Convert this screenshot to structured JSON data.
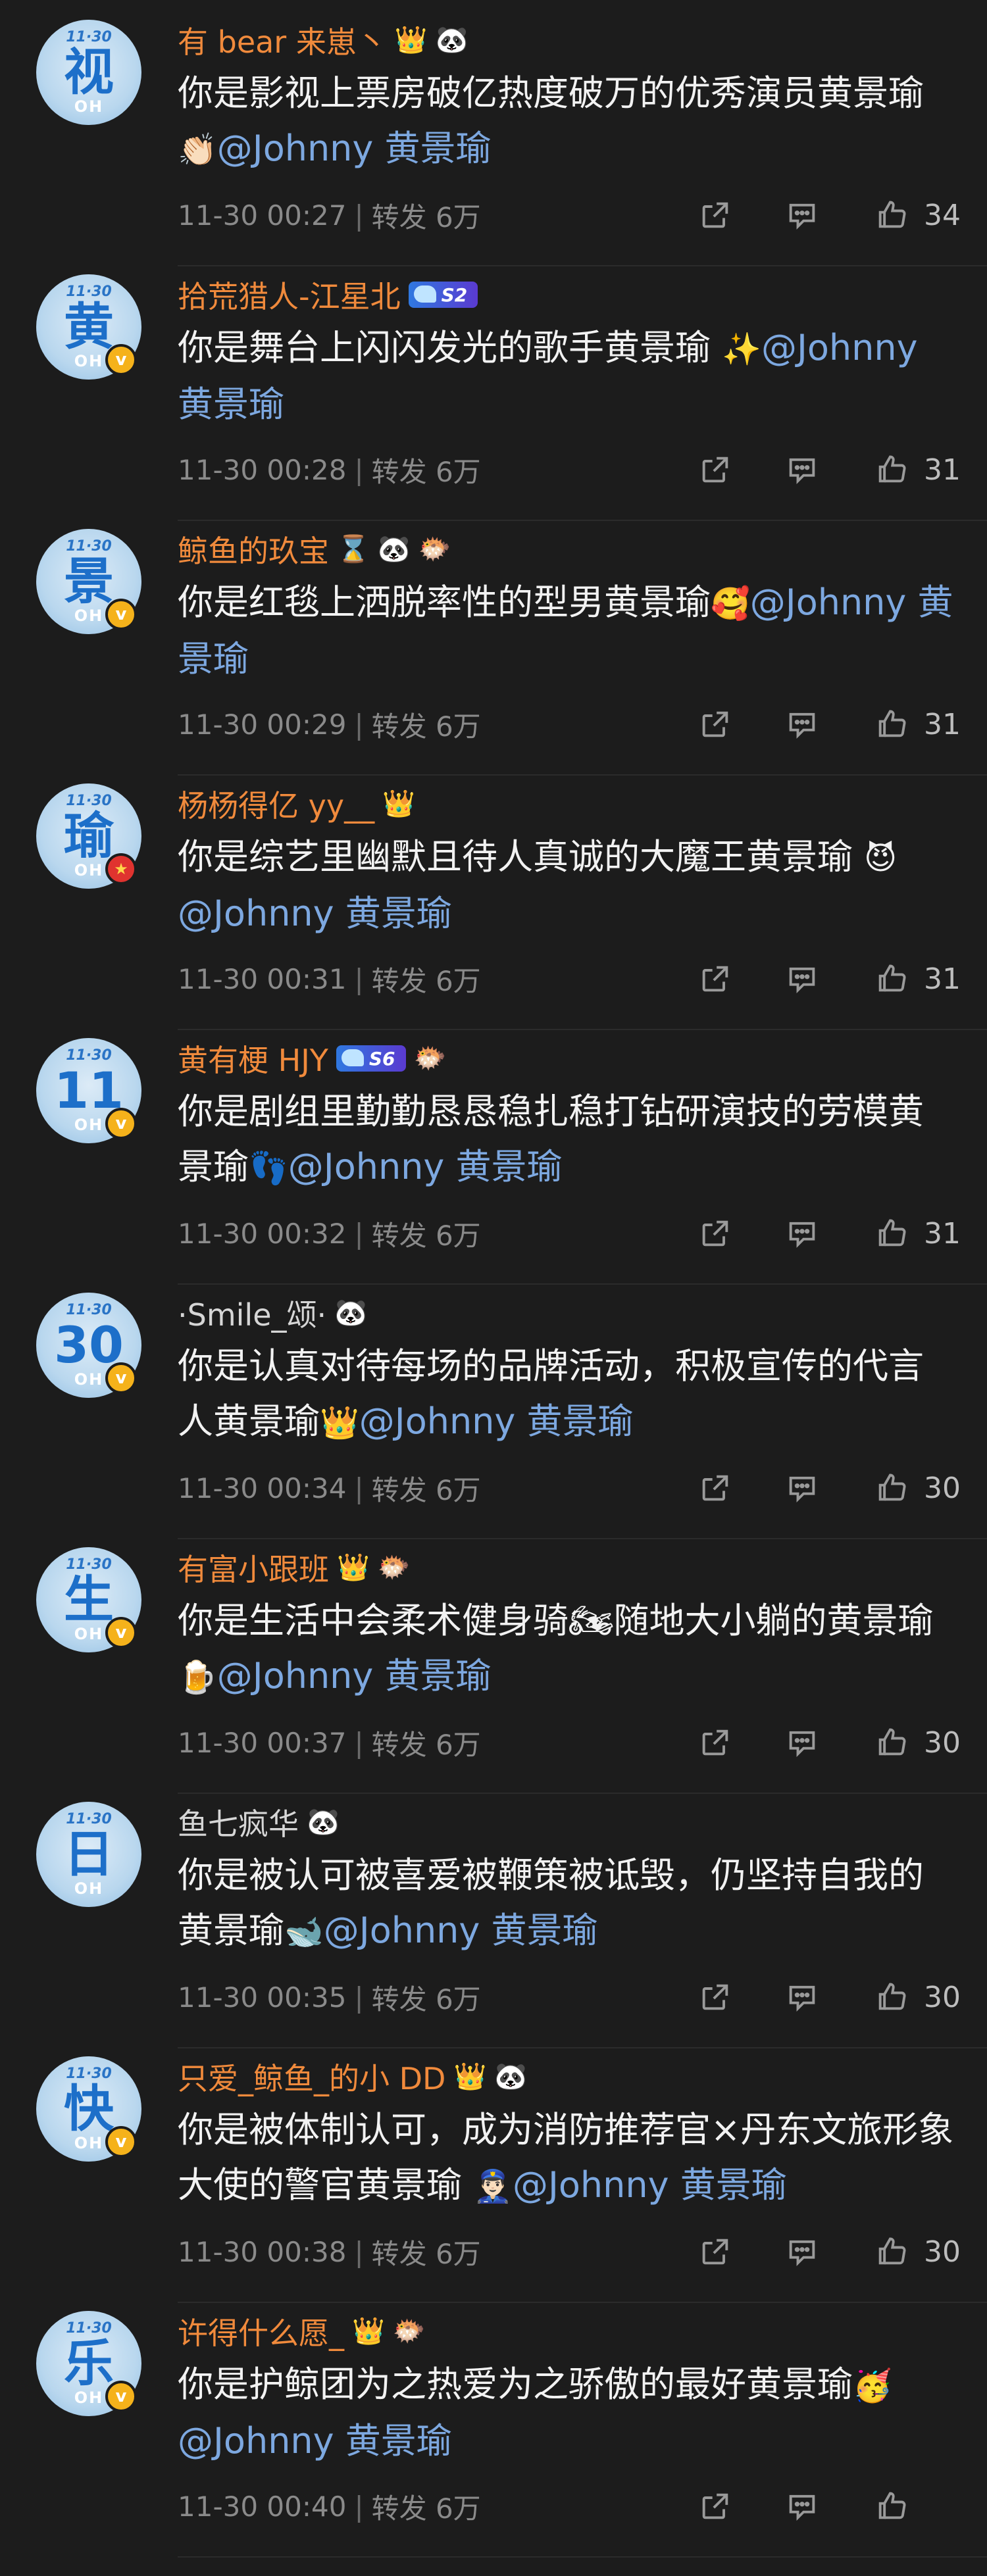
{
  "footer_labels": {
    "repost_prefix": "转发"
  },
  "colors": {
    "background": "#1c1c1c",
    "username_highlight": "#f08a3c",
    "mention": "#7da8e0",
    "meta": "#8a8a8a"
  },
  "comments": [
    {
      "avatar_char": "视",
      "avatar_top": "11·30",
      "avatar_bottom": "OH",
      "badge": "none",
      "username": "有 bear 来崽丶",
      "username_style": "orange",
      "medals": [
        "👑",
        "🐼"
      ],
      "level_badge": "",
      "text": "你是影视上票房破亿热度破万的优秀演员黄景瑜",
      "emoji": "👏🏻",
      "mention": "@Johnny 黄景瑜",
      "time": "11-30 00:27",
      "repost": "转发 6万",
      "likes": "34"
    },
    {
      "avatar_char": "黄",
      "avatar_top": "11·30",
      "avatar_bottom": "OH",
      "badge": "v",
      "username": "拾荒猎人-江星北",
      "username_style": "orange",
      "medals": [],
      "level_badge": "S2",
      "text": "你是舞台上闪闪发光的歌手黄景瑜 ",
      "emoji": "✨",
      "mention": "@Johnny 黄景瑜",
      "time": "11-30 00:28",
      "repost": "转发 6万",
      "likes": "31"
    },
    {
      "avatar_char": "景",
      "avatar_top": "11·30",
      "avatar_bottom": "OH",
      "badge": "v",
      "username": "鲸鱼的玖宝",
      "username_style": "orange",
      "medals": [
        "⌛",
        "🐼",
        "🐡"
      ],
      "level_badge": "",
      "text": "你是红毯上洒脱率性的型男黄景瑜",
      "emoji": "🥰",
      "mention": "@Johnny 黄景瑜",
      "time": "11-30 00:29",
      "repost": "转发 6万",
      "likes": "31"
    },
    {
      "avatar_char": "瑜",
      "avatar_top": "11·30",
      "avatar_bottom": "OH",
      "badge": "r",
      "username": "杨杨得亿 yy__",
      "username_style": "orange",
      "medals": [
        "👑"
      ],
      "level_badge": "",
      "text": "你是综艺里幽默且待人真诚的大魔王黄景瑜 ",
      "emoji": "😈",
      "mention": "@Johnny 黄景瑜",
      "time": "11-30 00:31",
      "repost": "转发 6万",
      "likes": "31"
    },
    {
      "avatar_char": "11",
      "avatar_top": "11·30",
      "avatar_bottom": "OH",
      "badge": "v",
      "username": "黄有梗 HJY",
      "username_style": "orange",
      "medals": [
        "🐡"
      ],
      "level_badge": "S6",
      "text": "你是剧组里勤勤恳恳稳扎稳打钻研演技的劳模黄景瑜",
      "emoji": "👣",
      "mention": "@Johnny 黄景瑜",
      "time": "11-30 00:32",
      "repost": "转发 6万",
      "likes": "31"
    },
    {
      "avatar_char": "30",
      "avatar_top": "11·30",
      "avatar_bottom": "OH",
      "badge": "v",
      "username": "·Smile_颂·",
      "username_style": "plain",
      "medals": [
        "🐼"
      ],
      "level_badge": "",
      "text": "你是认真对待每场的品牌活动，积极宣传的代言人黄景瑜",
      "emoji": "👑",
      "mention": "@Johnny 黄景瑜",
      "time": "11-30 00:34",
      "repost": "转发 6万",
      "likes": "30"
    },
    {
      "avatar_char": "生",
      "avatar_top": "11·30",
      "avatar_bottom": "OH",
      "badge": "v",
      "username": "有富小跟班",
      "username_style": "orange",
      "medals": [
        "👑",
        "🐡"
      ],
      "level_badge": "",
      "text": "你是生活中会柔术健身骑🏍随地大小躺的黄景瑜",
      "emoji": "🍺",
      "mention": "@Johnny 黄景瑜",
      "time": "11-30 00:37",
      "repost": "转发 6万",
      "likes": "30"
    },
    {
      "avatar_char": "日",
      "avatar_top": "11·30",
      "avatar_bottom": "OH",
      "badge": "none",
      "username": "鱼七疯华",
      "username_style": "plain",
      "medals": [
        "🐼"
      ],
      "level_badge": "",
      "text": "你是被认可被喜爱被鞭策被诋毁，仍坚持自我的黄景瑜",
      "emoji": "🐋",
      "mention": "@Johnny 黄景瑜",
      "time": "11-30 00:35",
      "repost": "转发 6万",
      "likes": "30"
    },
    {
      "avatar_char": "快",
      "avatar_top": "11·30",
      "avatar_bottom": "OH",
      "badge": "v",
      "username": "只爱_鲸鱼_的小 DD",
      "username_style": "orange",
      "medals": [
        "👑",
        "🐼"
      ],
      "level_badge": "",
      "text": "你是被体制认可，成为消防推荐官×丹东文旅形象大使的警官黄景瑜 ",
      "emoji": "👮🏻‍♂️",
      "mention": "@Johnny 黄景瑜",
      "time": "11-30 00:38",
      "repost": "转发 6万",
      "likes": "30"
    },
    {
      "avatar_char": "乐",
      "avatar_top": "11·30",
      "avatar_bottom": "OH",
      "badge": "v",
      "username": "许得什么愿_",
      "username_style": "orange",
      "medals": [
        "👑",
        "🐡"
      ],
      "level_badge": "",
      "text": "你是护鲸团为之热爱为之骄傲的最好黄景瑜",
      "emoji": "🥳",
      "mention": "@Johnny 黄景瑜",
      "time": "11-30 00:40",
      "repost": "转发 6万",
      "likes": ""
    }
  ]
}
